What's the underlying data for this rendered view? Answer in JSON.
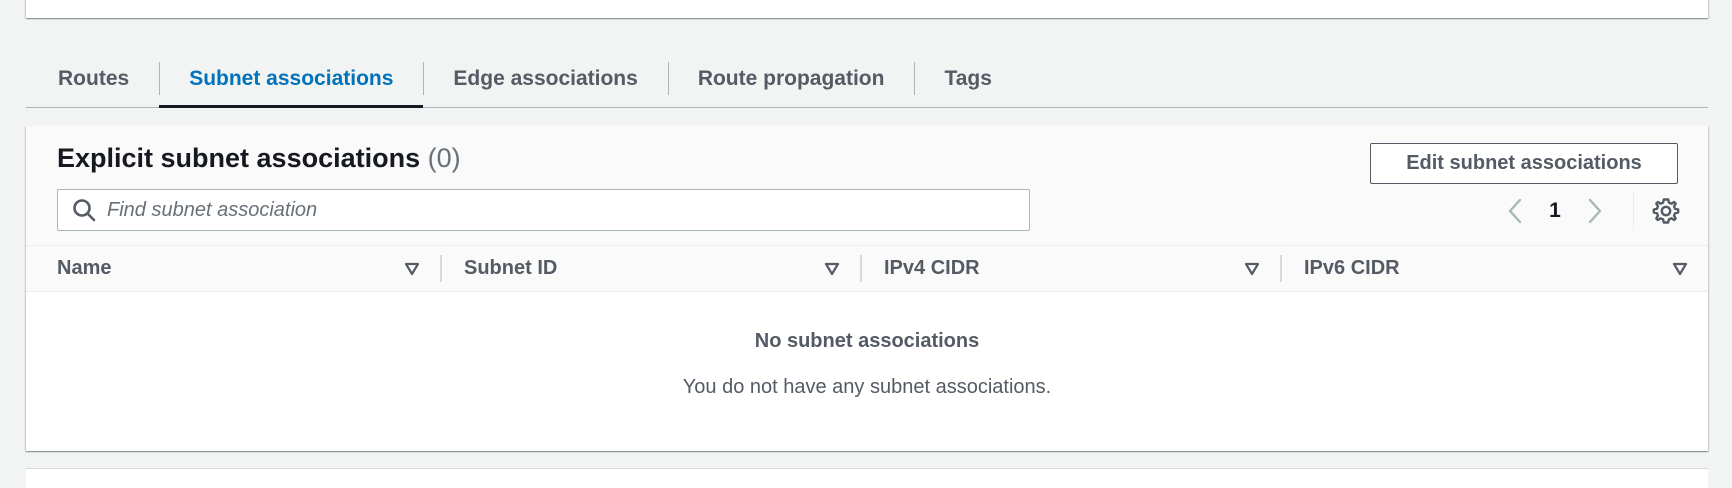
{
  "tabs": [
    {
      "label": "Routes",
      "active": false
    },
    {
      "label": "Subnet associations",
      "active": true
    },
    {
      "label": "Edge associations",
      "active": false
    },
    {
      "label": "Route propagation",
      "active": false
    },
    {
      "label": "Tags",
      "active": false
    }
  ],
  "panel": {
    "title": "Explicit subnet associations",
    "count": "(0)",
    "edit_button": "Edit subnet associations",
    "search_placeholder": "Find subnet association",
    "search_value": "",
    "icons": {
      "search": "search-icon",
      "prev": "chevron-left-icon",
      "next": "chevron-right-icon",
      "settings": "gear-icon",
      "sort": "sort-down-icon"
    }
  },
  "pagination": {
    "current_page": "1"
  },
  "table": {
    "columns": [
      "Name",
      "Subnet ID",
      "IPv4 CIDR",
      "IPv6 CIDR"
    ],
    "rows": []
  },
  "empty_state": {
    "title": "No subnet associations",
    "description": "You do not have any subnet associations."
  },
  "colors": {
    "accent": "#0073bb",
    "text": "#16191f",
    "muted": "#545b64",
    "border": "#aab7b8",
    "background": "#f2f3f3"
  }
}
